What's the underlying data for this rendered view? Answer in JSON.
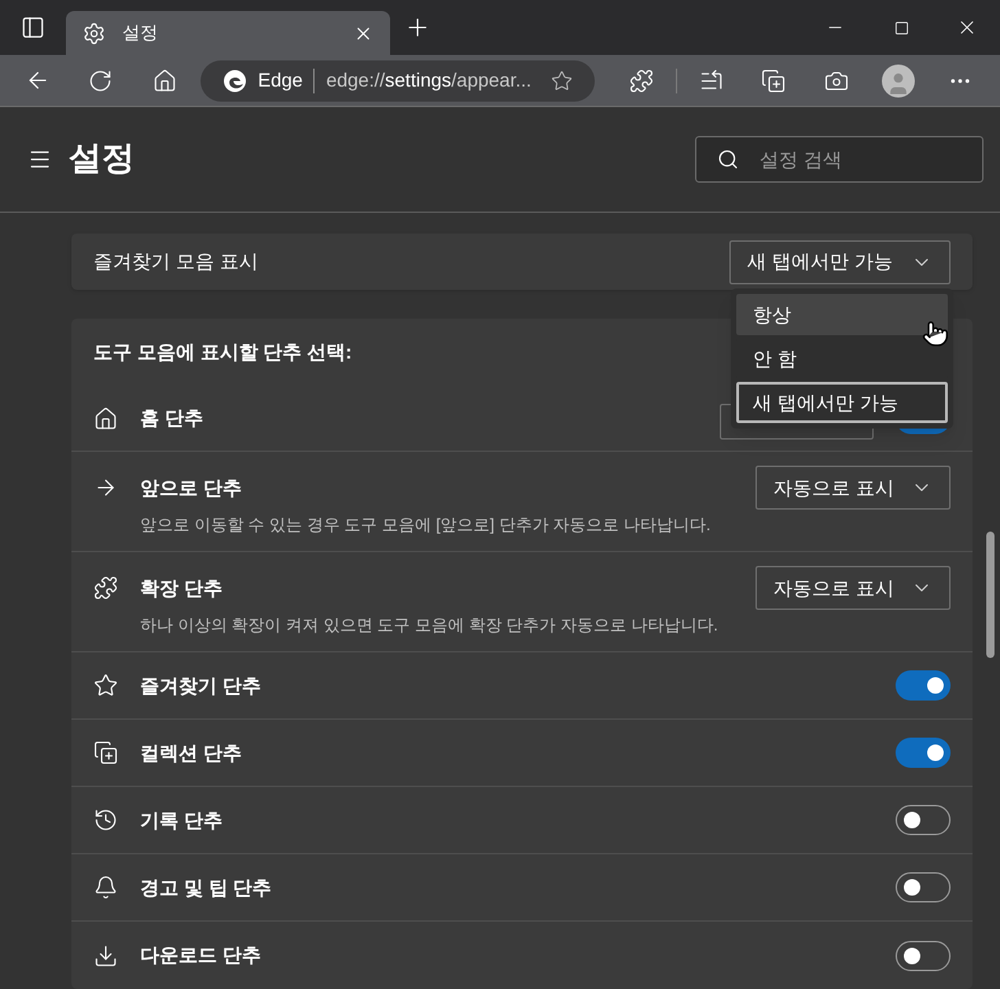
{
  "tab": {
    "title": "설정"
  },
  "address_bar": {
    "site": "Edge",
    "scheme": "edge://",
    "host": "settings",
    "path": "/appear..."
  },
  "page": {
    "title": "설정",
    "search": {
      "placeholder": "설정 검색"
    }
  },
  "favorites_bar": {
    "label": "즐겨찾기 모음 표시",
    "value": "새 탭에서만 가능",
    "menu": [
      {
        "label": "항상",
        "hovered": true,
        "selected": false
      },
      {
        "label": "안 함",
        "hovered": false,
        "selected": false
      },
      {
        "label": "새 탭에서만 가능",
        "hovered": false,
        "selected": true
      }
    ]
  },
  "toolbar_buttons": {
    "heading": "도구 모음에 표시할 단추 선택:",
    "rows": [
      {
        "kind": "home",
        "label": "홈 단추",
        "on": true
      },
      {
        "kind": "select",
        "label": "앞으로 단추",
        "value": "자동으로 표시",
        "description": "앞으로 이동할 수 있는 경우 도구 모음에 [앞으로] 단추가 자동으로 나타납니다."
      },
      {
        "kind": "select",
        "label": "확장 단추",
        "value": "자동으로 표시",
        "description": "하나 이상의 확장이 켜져 있으면 도구 모음에 확장 단추가 자동으로 나타납니다."
      },
      {
        "kind": "toggle",
        "label": "즐겨찾기 단추",
        "on": true
      },
      {
        "kind": "toggle",
        "label": "컬렉션 단추",
        "on": true
      },
      {
        "kind": "toggle",
        "label": "기록 단추",
        "on": false
      },
      {
        "kind": "toggle",
        "label": "경고 및 팁 단추",
        "on": false
      },
      {
        "kind": "toggle",
        "label": "다운로드 단추",
        "on": false
      }
    ]
  }
}
